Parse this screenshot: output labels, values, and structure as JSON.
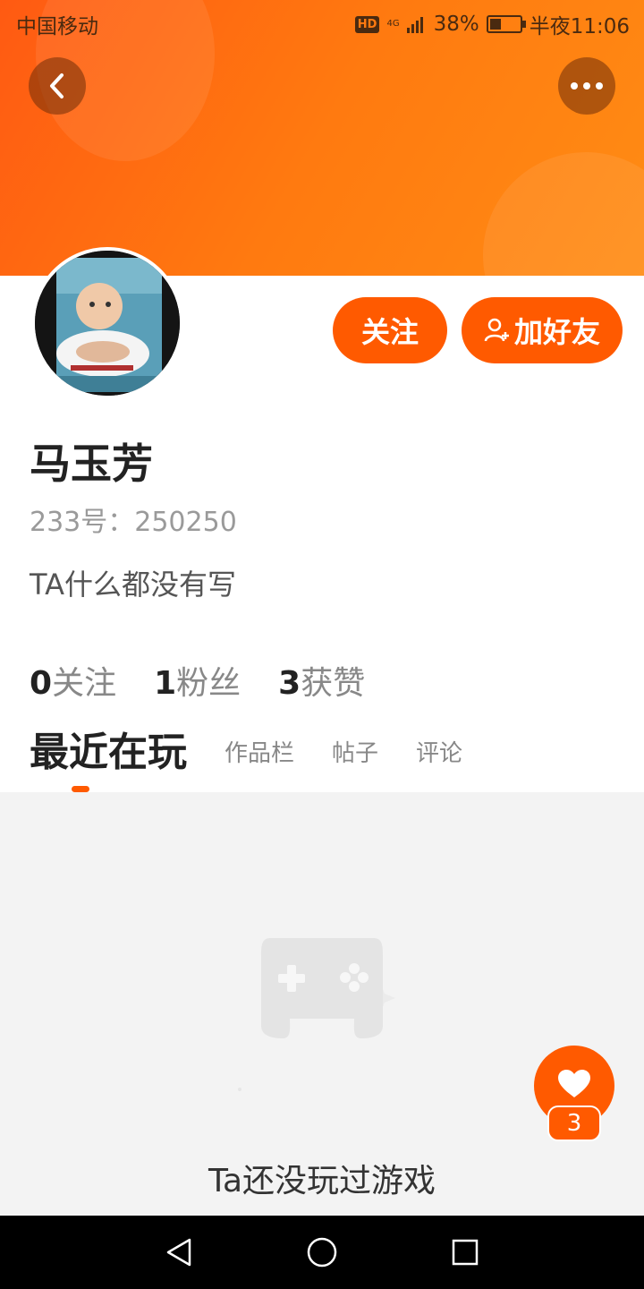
{
  "status_bar": {
    "carrier": "中国移动",
    "hd": "HD",
    "network": "4G",
    "battery": "38%",
    "battery_level": 0.38,
    "time": "半夜11:06"
  },
  "header": {
    "back_icon": "chevron-left-icon",
    "more_icon": "more-dots-icon",
    "accent_color": "#ff5a00"
  },
  "profile": {
    "follow_label": "关注",
    "add_friend_label": "加好友",
    "name": "马玉芳",
    "id_text": "233号：250250",
    "bio": "TA什么都没有写"
  },
  "stats": [
    {
      "value": "0",
      "label": "关注"
    },
    {
      "value": "1",
      "label": "粉丝"
    },
    {
      "value": "3",
      "label": "获赞"
    }
  ],
  "tabs": [
    {
      "label": "最近在玩",
      "active": true
    },
    {
      "label": "作品栏",
      "active": false
    },
    {
      "label": "帖子",
      "active": false
    },
    {
      "label": "评论",
      "active": false
    }
  ],
  "empty_state": {
    "icon": "gamepad-icon",
    "text": "Ta还没玩过游戏"
  },
  "like_button": {
    "icon": "heart-icon",
    "count": "3"
  },
  "nav": {
    "back": "triangle-back-icon",
    "home": "circle-home-icon",
    "recent": "square-recents-icon"
  }
}
